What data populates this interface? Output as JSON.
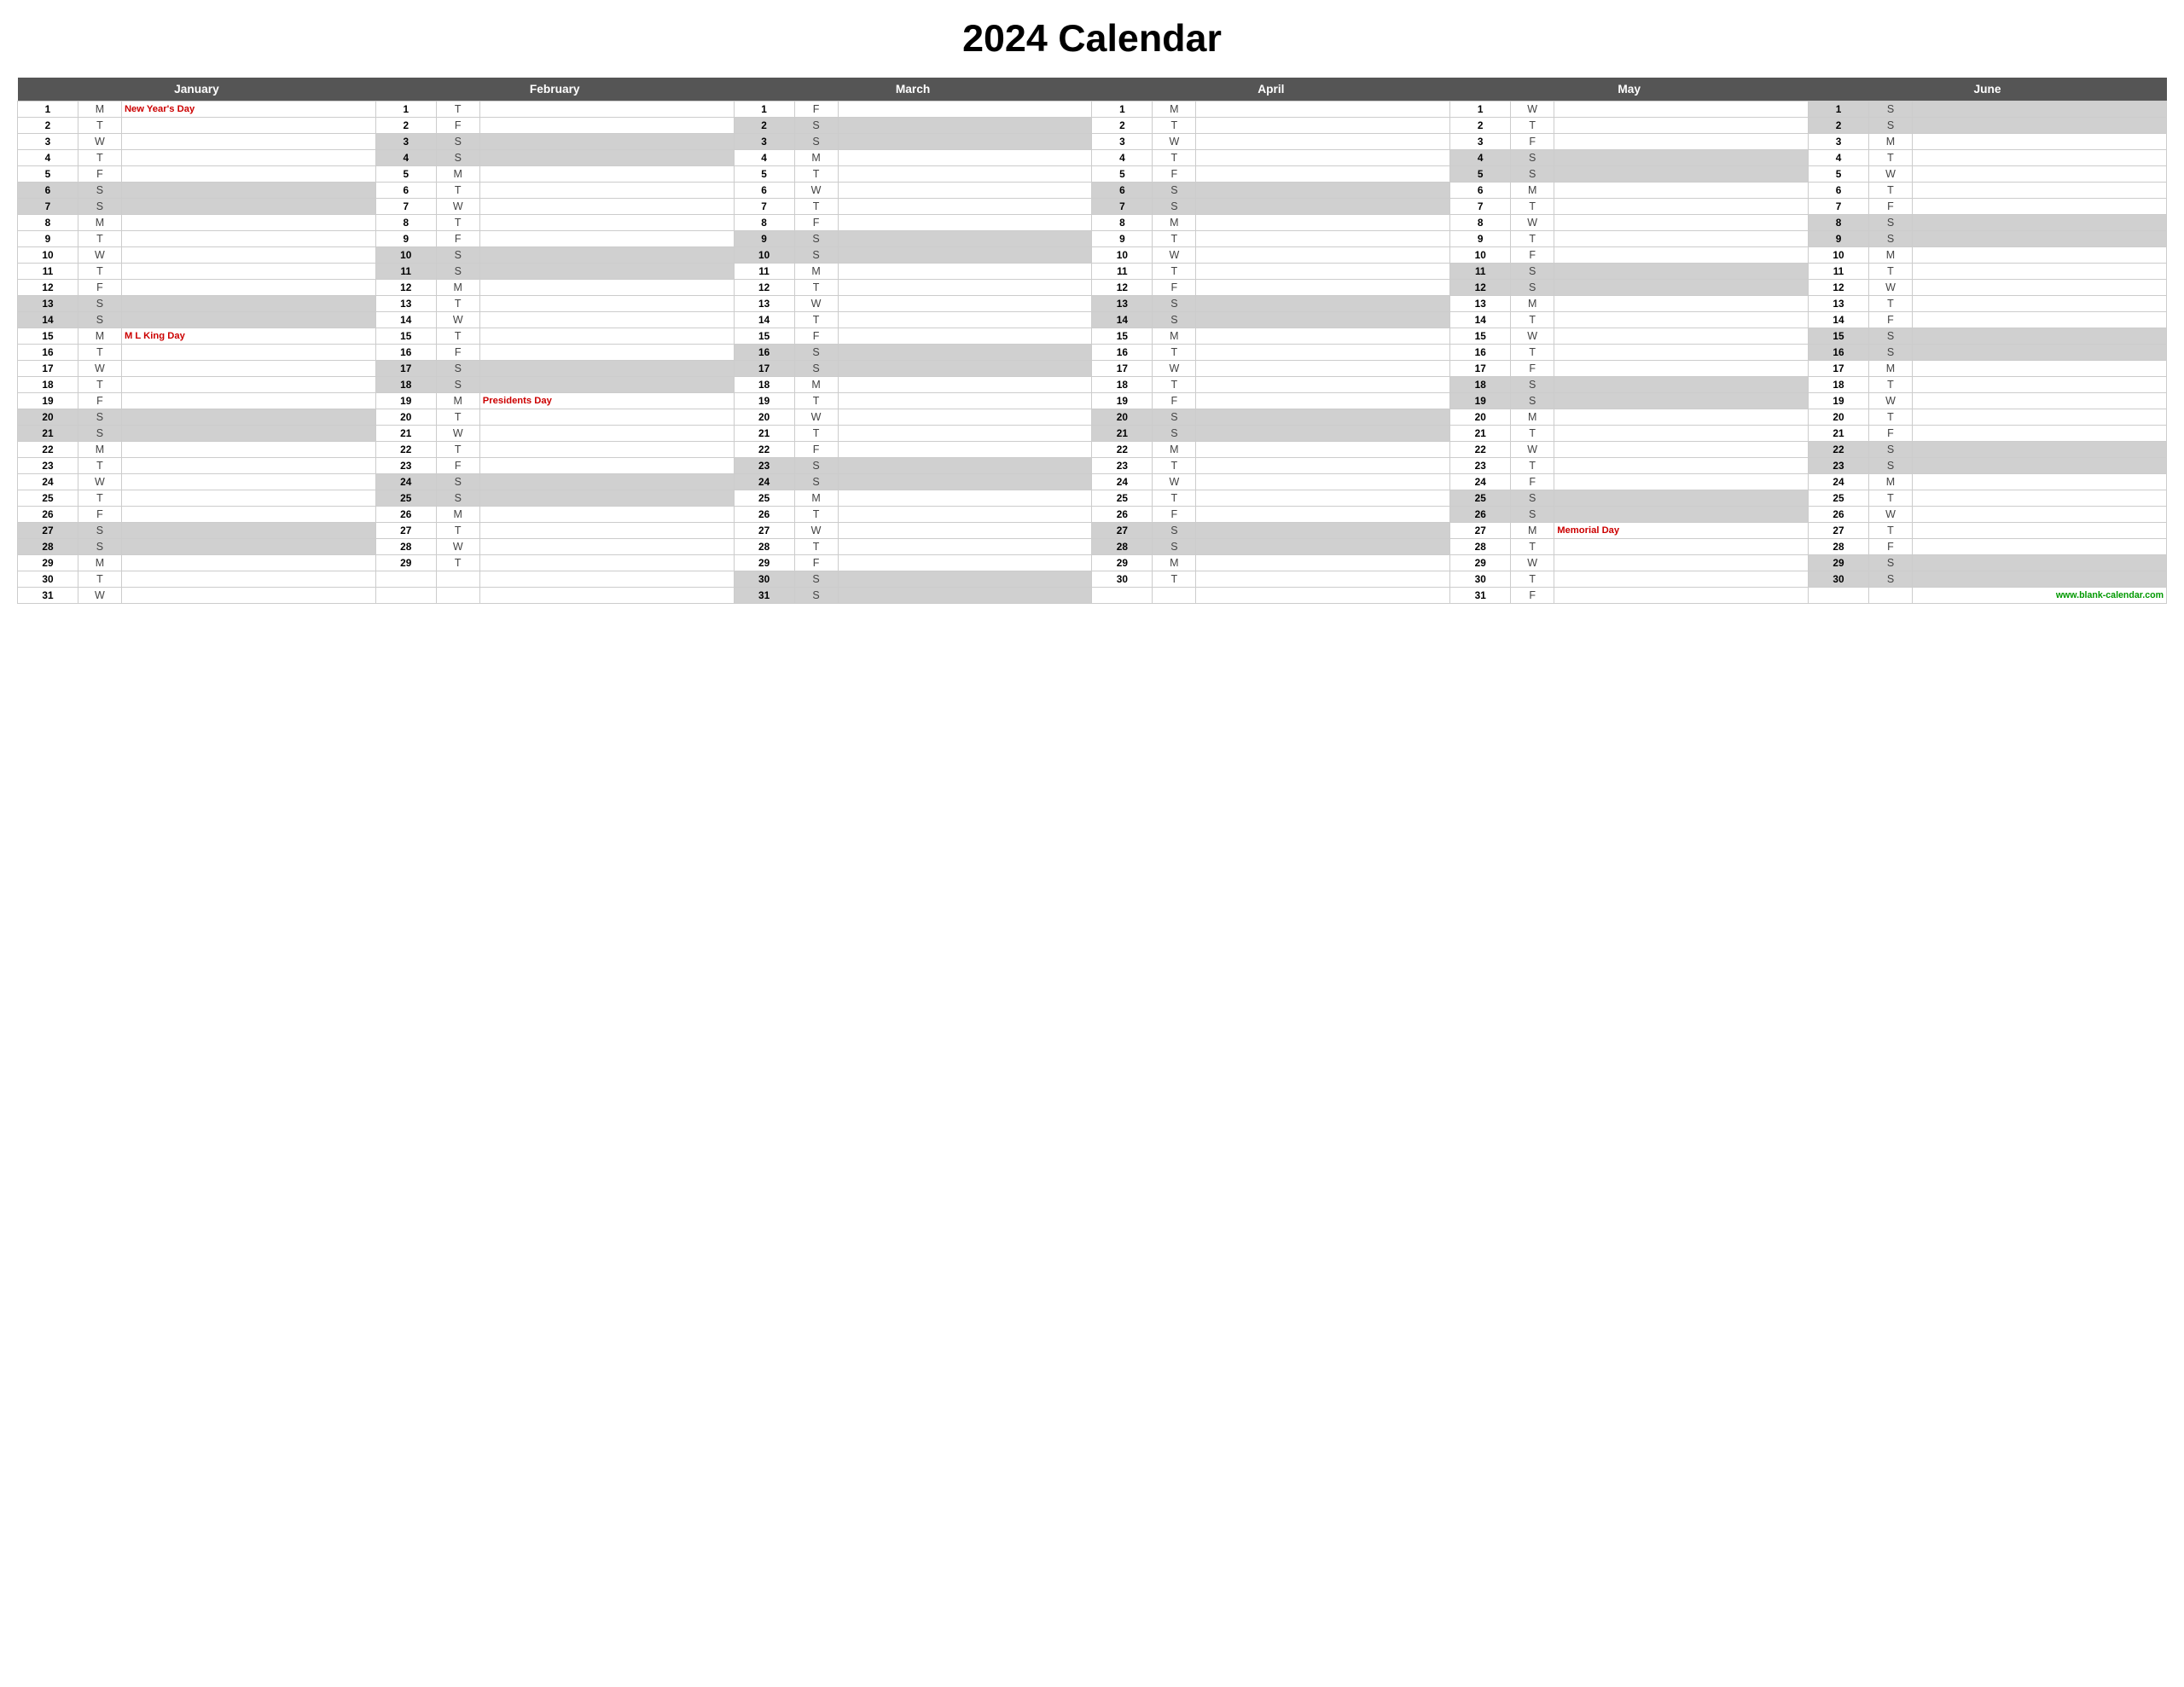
{
  "title": "2024 Calendar",
  "months": [
    "January",
    "February",
    "March",
    "April",
    "May",
    "June"
  ],
  "footer_url": "www.blank-calendar.com",
  "days_in_month": {
    "jan": 31,
    "feb": 29,
    "mar": 31,
    "apr": 30,
    "may": 31,
    "jun": 30
  },
  "day_letters": {
    "jan": [
      "M",
      "T",
      "W",
      "T",
      "F",
      "S",
      "S",
      "M",
      "T",
      "W",
      "T",
      "F",
      "S",
      "S",
      "M",
      "T",
      "W",
      "T",
      "F",
      "S",
      "S",
      "M",
      "T",
      "W",
      "T",
      "F",
      "S",
      "S",
      "M",
      "T",
      "W"
    ],
    "feb": [
      "T",
      "F",
      "S",
      "S",
      "M",
      "T",
      "W",
      "T",
      "F",
      "S",
      "S",
      "M",
      "T",
      "W",
      "T",
      "F",
      "S",
      "S",
      "M",
      "T",
      "W",
      "T",
      "F",
      "S",
      "S",
      "M",
      "T",
      "W",
      "T"
    ],
    "mar": [
      "F",
      "S",
      "S",
      "M",
      "T",
      "W",
      "T",
      "F",
      "S",
      "S",
      "M",
      "T",
      "W",
      "T",
      "F",
      "S",
      "S",
      "M",
      "T",
      "W",
      "T",
      "F",
      "S",
      "S",
      "M",
      "T",
      "W",
      "T",
      "F",
      "S",
      "S"
    ],
    "apr": [
      "M",
      "T",
      "W",
      "T",
      "F",
      "S",
      "S",
      "M",
      "T",
      "W",
      "T",
      "F",
      "S",
      "S",
      "M",
      "T",
      "W",
      "T",
      "F",
      "S",
      "S",
      "M",
      "T",
      "W",
      "T",
      "F",
      "S",
      "S",
      "M",
      "T"
    ],
    "may": [
      "W",
      "T",
      "F",
      "S",
      "S",
      "M",
      "T",
      "W",
      "T",
      "F",
      "S",
      "S",
      "M",
      "T",
      "W",
      "T",
      "F",
      "S",
      "S",
      "M",
      "T",
      "W",
      "T",
      "F",
      "S",
      "S",
      "M",
      "T",
      "W",
      "T",
      "F"
    ],
    "jun": [
      "S",
      "S",
      "M",
      "T",
      "W",
      "T",
      "F",
      "S",
      "S",
      "M",
      "T",
      "W",
      "T",
      "F",
      "S",
      "S",
      "M",
      "T",
      "W",
      "T",
      "F",
      "S",
      "S",
      "M",
      "T",
      "W",
      "T",
      "F",
      "S",
      "S"
    ]
  },
  "events": {
    "jan_1": "New Year's Day",
    "jan_15": "M L King Day",
    "feb_19": "Presidents Day",
    "may_27": "Memorial Day"
  }
}
